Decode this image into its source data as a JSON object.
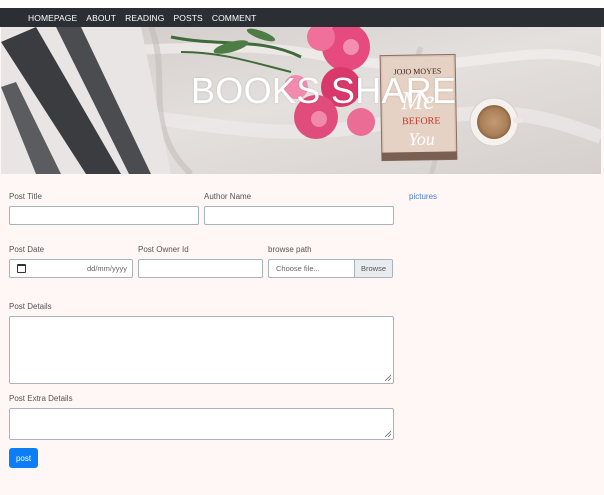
{
  "nav": {
    "items": [
      {
        "label": "HOMEPAGE"
      },
      {
        "label": "ABOUT"
      },
      {
        "label": "READING"
      },
      {
        "label": "POSTS"
      },
      {
        "label": "COMMENT"
      }
    ]
  },
  "hero": {
    "title": "BOOKS SHARE",
    "book": {
      "author": "JOJO MOYES",
      "title_line1": "Me",
      "title_line2": "BEFORE",
      "title_line3": "You"
    }
  },
  "form": {
    "post_title_label": "Post Title",
    "author_name_label": "Author Name",
    "post_date_label": "Post Date",
    "post_date_placeholder": "dd/mm/yyyy",
    "owner_id_label": "Post Owner Id",
    "browse_path_label": "browse path",
    "file_placeholder": "Choose file...",
    "browse_button": "Browse",
    "details_label": "Post Details",
    "extra_details_label": "Post Extra Details",
    "submit_label": "post"
  },
  "sidebar": {
    "pictures_link": "pictures"
  },
  "colors": {
    "navbar": "#2b2f33",
    "page_bg": "#fff6f6",
    "primary_button": "#0d7df5",
    "link": "#4a80c8"
  }
}
